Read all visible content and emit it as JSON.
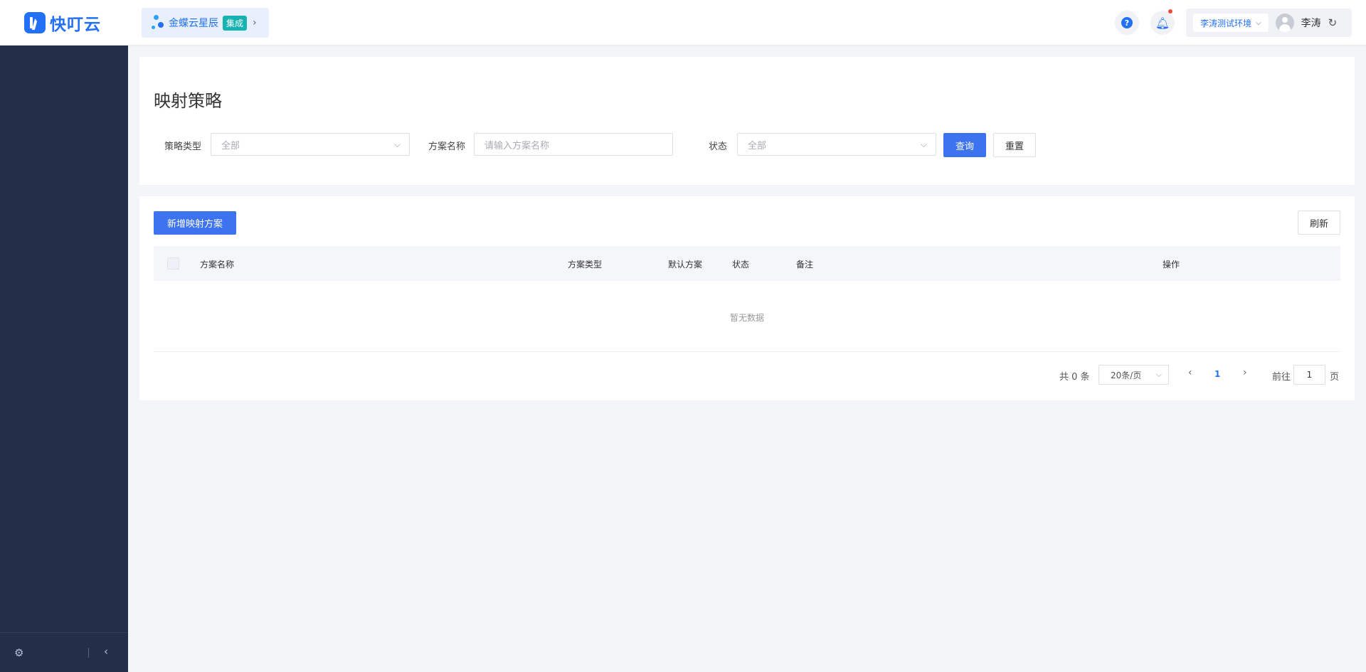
{
  "header": {
    "logo_text": "快叮云",
    "app": {
      "name": "金蝶云星辰",
      "badge": "集成"
    },
    "env": "李涛测试环境",
    "user": "李涛"
  },
  "page": {
    "title": "映射策略",
    "filters": {
      "strategy_type": {
        "label": "策略类型",
        "value": "全部"
      },
      "plan_name": {
        "label": "方案名称",
        "placeholder": "请输入方案名称"
      },
      "status": {
        "label": "状态",
        "value": "全部"
      },
      "query_label": "查询",
      "reset_label": "重置"
    },
    "table": {
      "add_label": "新增映射方案",
      "refresh_label": "刷新",
      "columns": [
        "方案名称",
        "方案类型",
        "默认方案",
        "状态",
        "备注",
        "操作"
      ],
      "empty_text": "暂无数据"
    },
    "pagination": {
      "total": "共 0 条",
      "page_size": "20条/页",
      "current": "1",
      "goto_prefix": "前往",
      "goto_value": "1",
      "goto_suffix": "页"
    }
  },
  "colors": {
    "primary": "#3e73f0",
    "sidebar": "#242e48",
    "teal_badge": "#17b3b3"
  }
}
